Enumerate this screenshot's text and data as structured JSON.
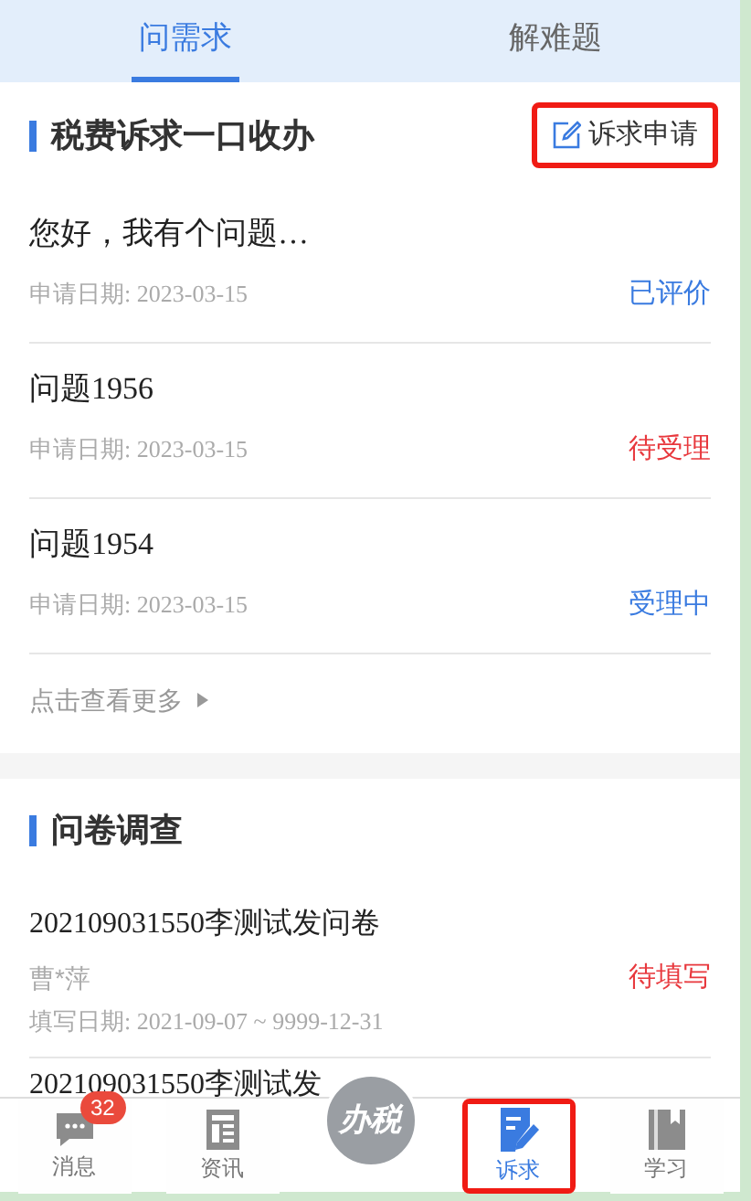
{
  "tabs": [
    {
      "label": "问需求",
      "selected": true
    },
    {
      "label": "解难题",
      "selected": false
    }
  ],
  "appeals": {
    "title": "税费诉求一口收办",
    "apply_button": {
      "label": "诉求申请",
      "highlighted": true
    },
    "items": [
      {
        "title": "您好，我有个问题…",
        "date_label": "申请日期:",
        "date": "2023-03-15",
        "status": "已评价",
        "color": "#3a7be0"
      },
      {
        "title": "问题1956",
        "date_label": "申请日期:",
        "date": "2023-03-15",
        "status": "待受理",
        "color": "#e8383d"
      },
      {
        "title": "问题1954",
        "date_label": "申请日期:",
        "date": "2023-03-15",
        "status": "受理中",
        "color": "#3a7be0"
      }
    ],
    "more": "点击查看更多"
  },
  "surveys": {
    "title": "问卷调查",
    "items": [
      {
        "title": "202109031550李测试发问卷",
        "person": "曹*萍",
        "date_label": "填写日期:",
        "date": "2021-09-07 ~ 9999-12-31",
        "status": "待填写",
        "color": "#e8383d"
      }
    ],
    "partial_title": "202109031550李测试发"
  },
  "bottom_nav": {
    "items": [
      {
        "kind": "message",
        "label": "消息",
        "badge": "32",
        "selected": false,
        "highlighted": false
      },
      {
        "kind": "news",
        "label": "资讯",
        "selected": false,
        "highlighted": false
      },
      {
        "kind": "center",
        "label": "办税"
      },
      {
        "kind": "appeal",
        "label": "诉求",
        "selected": true,
        "highlighted": true
      },
      {
        "kind": "study",
        "label": "学习",
        "selected": false,
        "highlighted": false
      }
    ]
  }
}
